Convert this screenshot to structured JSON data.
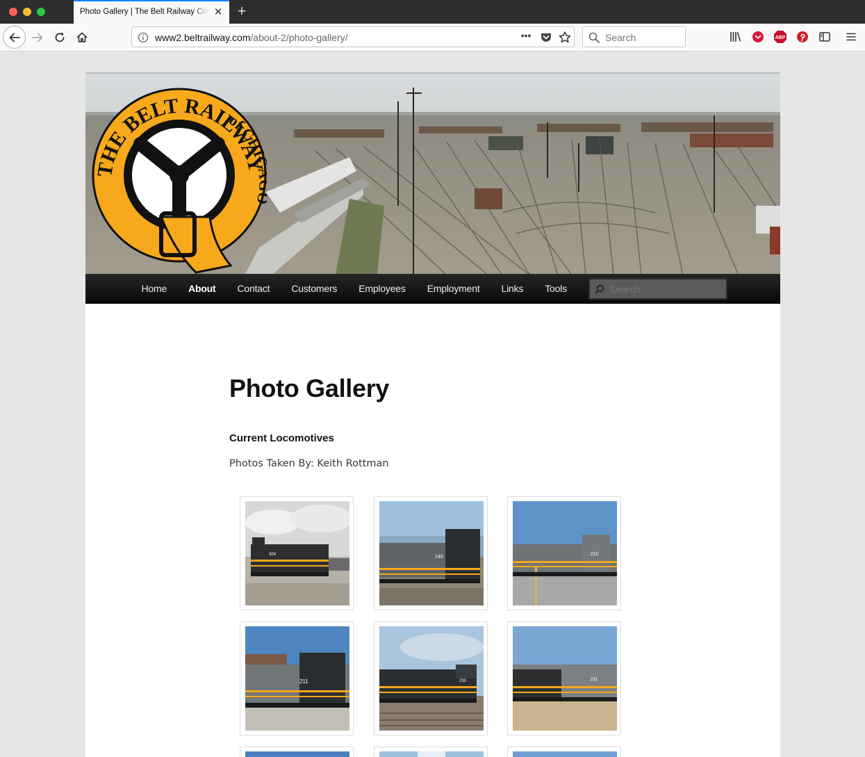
{
  "browser": {
    "tab_title": "Photo Gallery | The Belt Railway Company of Chicago",
    "tab_close": "✕",
    "new_tab": "+",
    "url_host": "www2.beltrailway.com",
    "url_path": "/about-2/photo-gallery/",
    "page_actions": "•••",
    "search_placeholder": "Search",
    "toolbar_icons": [
      "library-icon",
      "pocket-icon",
      "adblock-icon",
      "pinterest-icon",
      "sidebar-icon",
      "menu-icon"
    ],
    "adblock_label": "ABP"
  },
  "site": {
    "logo_text_top": "THE BELT RAILWAY COMPANY",
    "logo_text_side": "of CHICAGO",
    "nav": [
      {
        "label": "Home",
        "active": false
      },
      {
        "label": "About",
        "active": true
      },
      {
        "label": "Contact",
        "active": false
      },
      {
        "label": "Customers",
        "active": false
      },
      {
        "label": "Employees",
        "active": false
      },
      {
        "label": "Employment",
        "active": false
      },
      {
        "label": "Links",
        "active": false
      },
      {
        "label": "Tools",
        "active": false
      }
    ],
    "search_placeholder": "Search",
    "accent": "#f7a81b"
  },
  "content": {
    "title": "Photo Gallery",
    "subhead": "Current Locomotives",
    "credit": "Photos Taken By: Keith Rottman",
    "photos": [
      {
        "number": "304"
      },
      {
        "number": "140"
      },
      {
        "number": "210"
      },
      {
        "number": "211"
      },
      {
        "number": "230"
      },
      {
        "number": "231"
      }
    ]
  }
}
